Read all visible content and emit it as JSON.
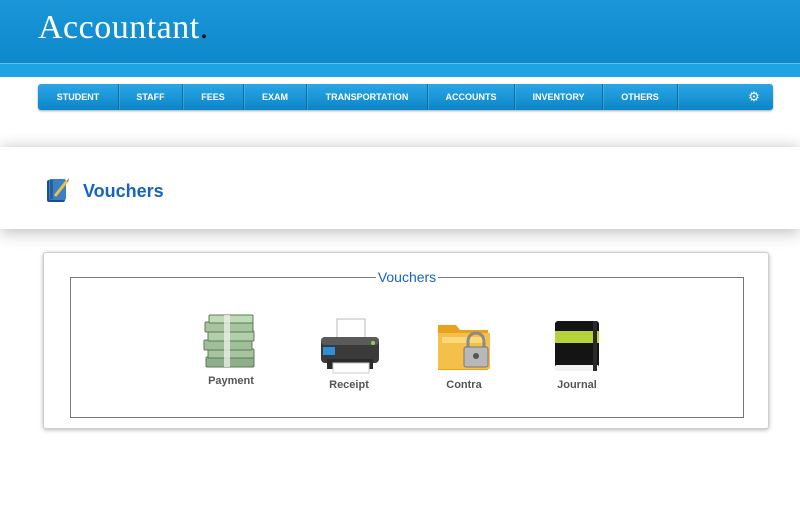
{
  "header": {
    "title": "Accountant",
    "title_dot": "."
  },
  "nav": {
    "items": [
      "STUDENT",
      "STAFF",
      "FEES",
      "EXAM",
      "TRANSPORTATION",
      "ACCOUNTS",
      "INVENTORY",
      "OTHERS"
    ],
    "settings_icon": "gear-icon"
  },
  "page": {
    "title": "Vouchers",
    "title_icon": "book-icon"
  },
  "vouchers": {
    "legend": "Vouchers",
    "items": [
      {
        "label": "Payment",
        "icon": "money-stack-icon"
      },
      {
        "label": "Receipt",
        "icon": "printer-icon"
      },
      {
        "label": "Contra",
        "icon": "locked-folder-icon"
      },
      {
        "label": "Journal",
        "icon": "notebook-icon"
      }
    ]
  },
  "colors": {
    "header_blue": "#0d88cc",
    "nav_blue": "#1a97d8",
    "title_blue": "#1565c0",
    "label_gray": "#555555"
  }
}
